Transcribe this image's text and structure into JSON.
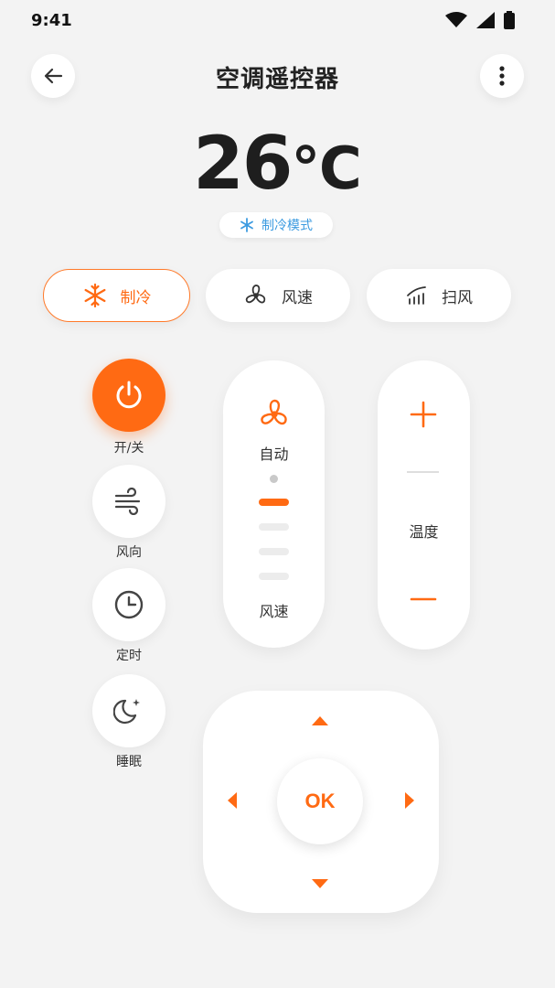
{
  "status_bar": {
    "time": "9:41"
  },
  "header": {
    "title": "空调遥控器"
  },
  "temperature": {
    "value": "26",
    "unit": "℃"
  },
  "mode_chip": {
    "label": "制冷模式"
  },
  "modes": [
    {
      "label": "制冷",
      "icon": "snowflake-icon",
      "active": true
    },
    {
      "label": "风速",
      "icon": "fan-icon",
      "active": false
    },
    {
      "label": "扫风",
      "icon": "swing-icon",
      "active": false
    }
  ],
  "side_buttons": [
    {
      "label": "开/关",
      "icon": "power-icon"
    },
    {
      "label": "风向",
      "icon": "wind-icon"
    },
    {
      "label": "定时",
      "icon": "clock-icon"
    },
    {
      "label": "睡眠",
      "icon": "moon-icon"
    }
  ],
  "fan_panel": {
    "mode_label": "自动",
    "label": "风速",
    "active_level": 1,
    "total_levels": 4
  },
  "temp_panel": {
    "label": "温度"
  },
  "dpad": {
    "ok_label": "OK"
  },
  "colors": {
    "accent": "#ff6a13",
    "cool_blue": "#3c9be0",
    "background": "#f3f3f3"
  }
}
